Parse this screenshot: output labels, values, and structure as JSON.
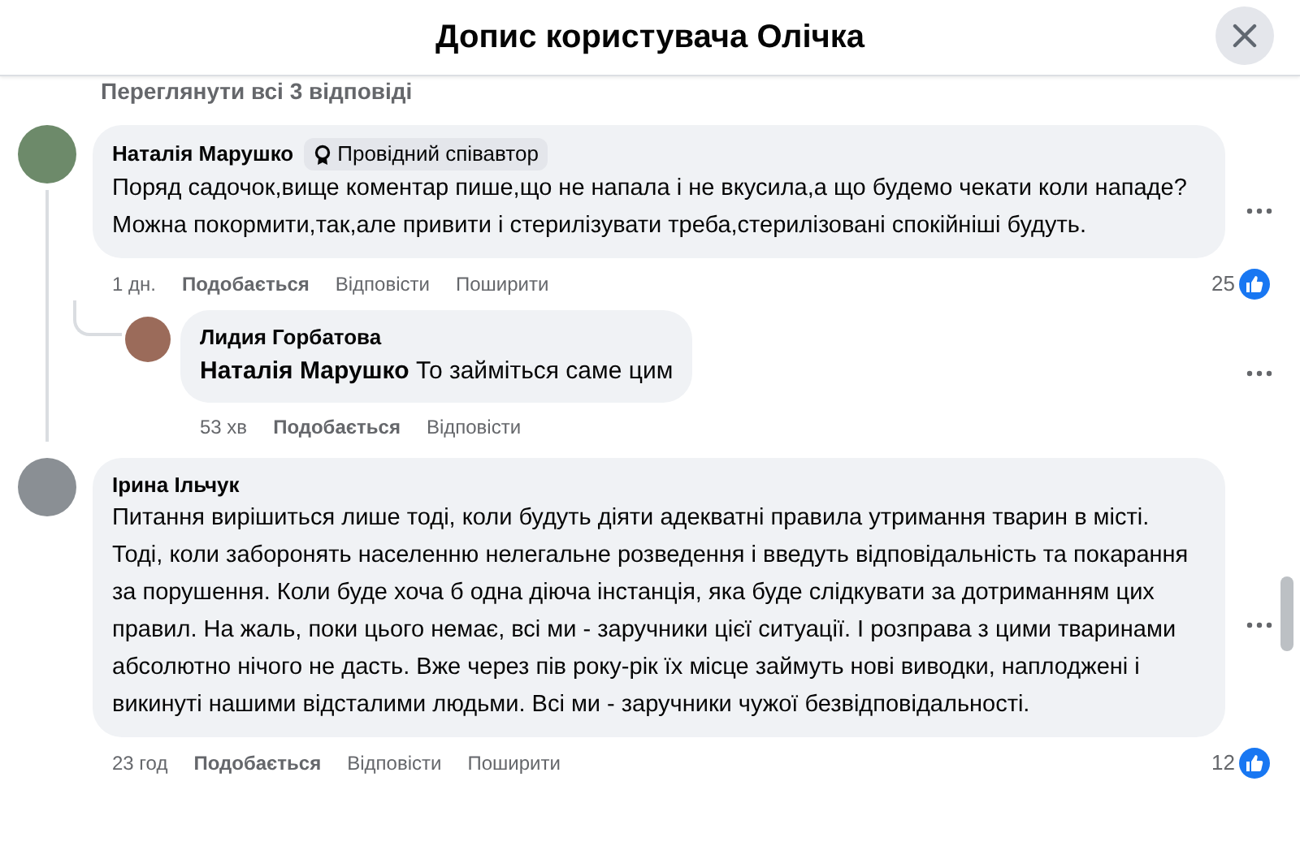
{
  "header": {
    "title": "Допис користувача Олічка"
  },
  "view_replies": "Переглянути всі 3 відповіді",
  "comments": [
    {
      "author": "Наталія Марушко",
      "badge": "Провідний співавтор",
      "text": "Поряд садочок,вище коментар пише,що не напала і не вкусила,а що будемо чекати коли нападе?Можна покормити,так,але привити і стерилізувати треба,стерилізовані спокійніші будуть.",
      "time": "1 дн.",
      "actions": [
        {
          "label": "Подобається",
          "kind": "like"
        },
        {
          "label": "Відповісти",
          "kind": "reply"
        },
        {
          "label": "Поширити",
          "kind": "share"
        }
      ],
      "reactions": "25",
      "replies": [
        {
          "author": "Лидия Горбатова",
          "mention": "Наталія Марушко",
          "text": "То займіться саме цим",
          "time": "53 хв",
          "actions": [
            {
              "label": "Подобається",
              "kind": "like"
            },
            {
              "label": "Відповісти",
              "kind": "reply"
            }
          ]
        }
      ]
    },
    {
      "author": "Ірина Ільчук",
      "text": "Питання вирішиться лише тоді, коли будуть діяти адекватні правила утримання тварин в місті. Тоді, коли заборонять населенню нелегальне розведення і введуть відповідальність та покарання за порушення. Коли буде хоча б одна діюча інстанція, яка буде слідкувати за дотриманням цих правил. На жаль, поки цього немає, всі ми - заручники цієї ситуації. І розправа з цими тваринами абсолютно нічого не дасть. Вже через пів року-рік їх місце займуть нові виводки, наплоджені і викинуті нашими відсталими людьми. Всі ми - заручники чужої безвідповідальності.",
      "time": "23 год",
      "actions": [
        {
          "label": "Подобається",
          "kind": "like"
        },
        {
          "label": "Відповісти",
          "kind": "reply"
        },
        {
          "label": "Поширити",
          "kind": "share"
        }
      ],
      "reactions": "12"
    }
  ]
}
